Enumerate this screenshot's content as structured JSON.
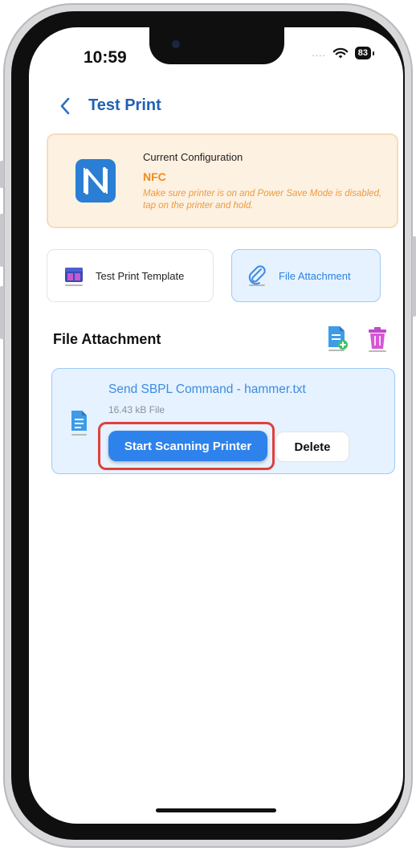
{
  "status_bar": {
    "time": "10:59",
    "signal": "....",
    "battery": "83"
  },
  "nav": {
    "title": "Test Print"
  },
  "config": {
    "label": "Current Configuration",
    "mode": "NFC",
    "note": "Make sure printer is on and Power Save Mode is disabled, tap on the printer and hold."
  },
  "tabs": [
    {
      "label": "Test Print Template",
      "icon": "template-icon",
      "selected": false
    },
    {
      "label": "File Attachment",
      "icon": "paperclip-icon",
      "selected": true
    }
  ],
  "section": {
    "title": "File Attachment"
  },
  "attachment": {
    "name": "Send SBPL Command - hammer.txt",
    "size": "16.43 kB File",
    "primary_button": "Start Scanning Printer",
    "secondary_button": "Delete"
  },
  "colors": {
    "accent": "#2e82ec",
    "title_blue": "#1f62b4",
    "nfc_orange": "#ef8a1f",
    "highlight_red": "#e0403c"
  }
}
